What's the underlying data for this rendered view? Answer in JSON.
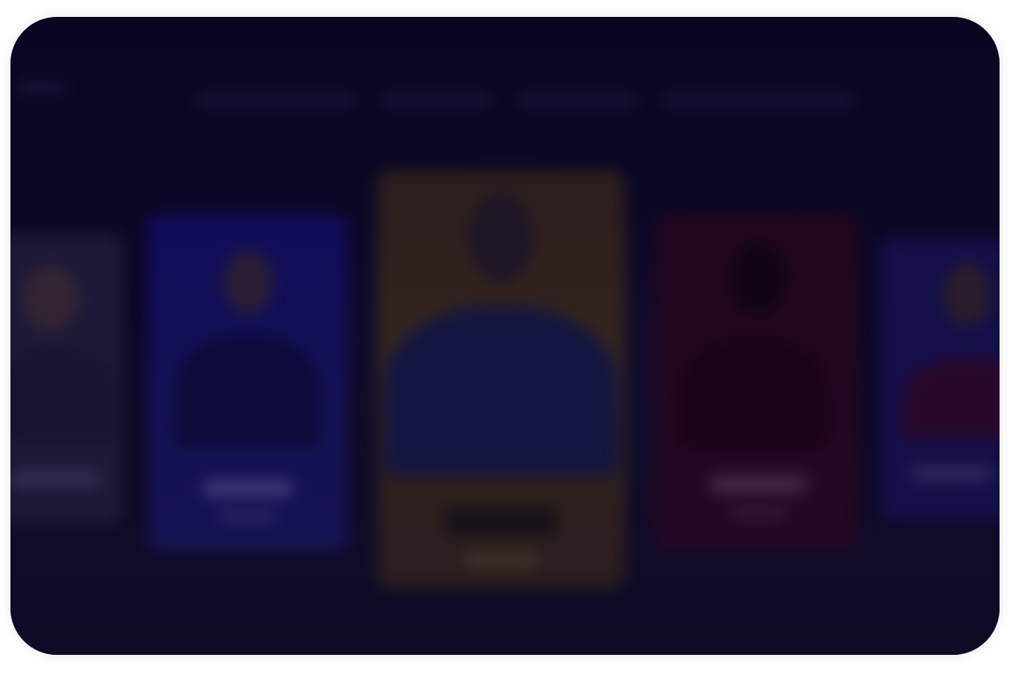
{
  "colors": {
    "background": "#0b0626",
    "card_left": "#1d1a6e",
    "card_center": "#4a3520",
    "card_right": "#330a28"
  },
  "carousel": {
    "cards": [
      {
        "position": "far-left"
      },
      {
        "position": "left"
      },
      {
        "position": "center"
      },
      {
        "position": "right"
      },
      {
        "position": "far-right"
      }
    ]
  }
}
